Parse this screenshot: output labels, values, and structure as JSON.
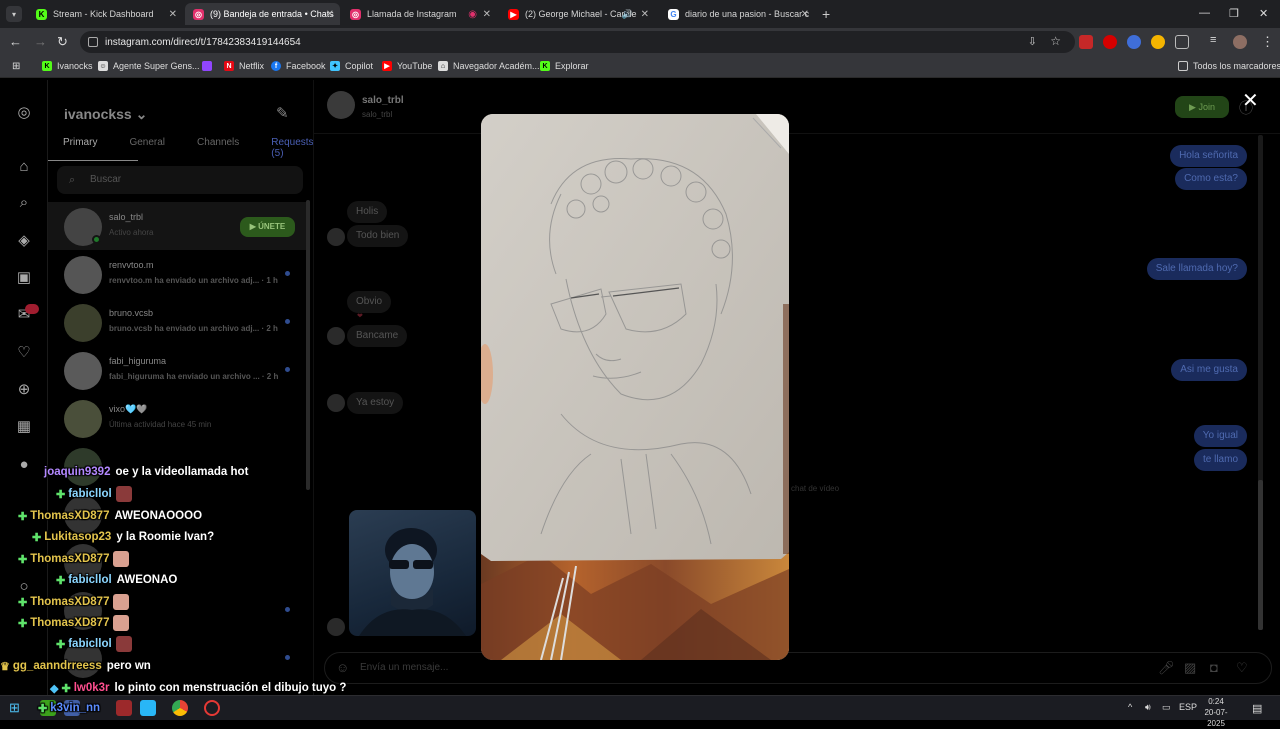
{
  "browser": {
    "tabs": [
      {
        "title": "Stream - Kick Dashboard",
        "favicon": "K",
        "color": "#53fc18"
      },
      {
        "title": "(9) Bandeja de entrada • Chats",
        "favicon": "◎",
        "color": "#e1306c",
        "active": true
      },
      {
        "title": "Llamada de Instagram",
        "favicon": "◎",
        "color": "#e1306c"
      },
      {
        "title": "(2) George Michael - Carele",
        "favicon": "▶",
        "color": "#ff0000"
      },
      {
        "title": "diario de una pasion - Buscar c",
        "favicon": "G",
        "color": "#ffffff"
      }
    ],
    "url": "instagram.com/direct/t/17842383419144654",
    "bookmarks": [
      {
        "label": "Ivanocks",
        "color": "#53fc18",
        "glyph": "K"
      },
      {
        "label": "Agente Super Gens...",
        "color": "#dddddd",
        "glyph": "☺"
      },
      {
        "label": "",
        "color": "#9146ff",
        "glyph": "▮"
      },
      {
        "label": "Netflix",
        "color": "#e50914",
        "glyph": "N"
      },
      {
        "label": "Facebook",
        "color": "#1877f2",
        "glyph": "f"
      },
      {
        "label": "Copilot",
        "color": "#40c4ff",
        "glyph": "✦"
      },
      {
        "label": "YouTube",
        "color": "#ff0000",
        "glyph": "▶"
      },
      {
        "label": "Navegador Académ...",
        "color": "#dddddd",
        "glyph": "⌂"
      },
      {
        "label": "Explorar",
        "color": "#53fc18",
        "glyph": "K"
      }
    ],
    "all_bookmarks": "Todos los marcadores"
  },
  "dm": {
    "username": "ivanockss",
    "tabs": [
      "Primary",
      "General",
      "Channels",
      "Requests (5)"
    ],
    "search_placeholder": "Buscar",
    "conversations": [
      {
        "name": "salo_trbl",
        "preview": "Activo ahora",
        "button": "ÚNETE"
      },
      {
        "name": "renvvtoo.m",
        "preview": "renvvtoo.m ha enviado un archivo adj... · 1 h"
      },
      {
        "name": "bruno.vcsb",
        "preview": "bruno.vcsb ha enviado un archivo adj... · 2 h"
      },
      {
        "name": "fabi_higuruma",
        "preview": "fabi_higuruma ha enviado un archivo ... · 2 h"
      },
      {
        "name": "vixo🩵🩶",
        "preview": "Última actividad hace 45 min"
      }
    ]
  },
  "chat": {
    "name": "salo_trbl",
    "sub": "salo_trbl",
    "join": "Join",
    "messages_in": [
      "Holis",
      "Todo bien",
      "Obvio",
      "Bancame",
      "Ya estoy"
    ],
    "messages_out": [
      "Hola señorita",
      "Como esta?",
      "Sale llamada hoy?",
      "Asi me gusta",
      "Yo igual",
      "te llamo"
    ],
    "system": "chat de vídeo",
    "input_placeholder": "Envía un mensaje..."
  },
  "stream_chat": [
    {
      "user": "joaquin9392",
      "color": "#b388ff",
      "msg": "oe y la videollamada hot",
      "badge": false
    },
    {
      "user": "fabicllol",
      "color": "#8bd6ff",
      "msg": "",
      "badge": true,
      "emote": true
    },
    {
      "user": "ThomasXD877",
      "color": "#e3c44c",
      "msg": "AWEONAOOOO",
      "badge": true
    },
    {
      "user": "Lukitasop23",
      "color": "#e3c44c",
      "msg": "y la Roomie Ivan?",
      "badge": true
    },
    {
      "user": "ThomasXD877",
      "color": "#e3c44c",
      "msg": "",
      "badge": true,
      "emote": true
    },
    {
      "user": "fabicllol",
      "color": "#8bd6ff",
      "msg": "AWEONAO",
      "badge": true
    },
    {
      "user": "ThomasXD877",
      "color": "#e3c44c",
      "msg": "",
      "badge": true,
      "emote": true
    },
    {
      "user": "ThomasXD877",
      "color": "#e3c44c",
      "msg": "",
      "badge": true,
      "emote": true
    },
    {
      "user": "fabicllol",
      "color": "#8bd6ff",
      "msg": "",
      "badge": true,
      "emote": true
    },
    {
      "user": "gg_aanndrreess",
      "color": "#e3c44c",
      "msg": "pero wn",
      "badge": false
    },
    {
      "user": "lw0k3r",
      "color": "#ff4f8f",
      "msg": "lo pinto con menstruación el dibujo tuyo ?",
      "badge": true
    },
    {
      "user": "k3vin_nn",
      "color": "#5b8cff",
      "msg": "",
      "badge": true
    }
  ],
  "taskbar": {
    "lang": "ESP",
    "time": "0:24",
    "date": "20-07-2025"
  }
}
